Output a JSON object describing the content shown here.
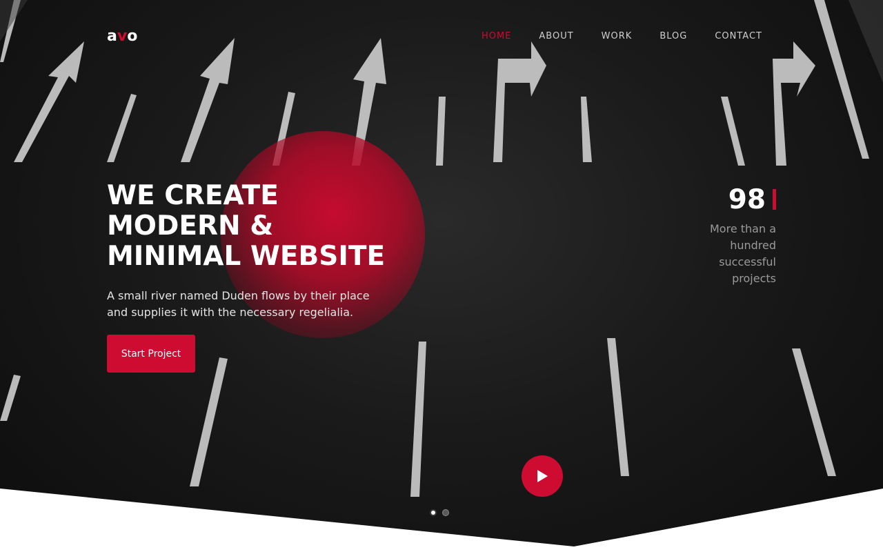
{
  "brand": {
    "logo_prefix": "a",
    "logo_accent": "v",
    "logo_suffix": "o"
  },
  "nav": {
    "items": [
      {
        "label": "HOME",
        "active": true
      },
      {
        "label": "ABOUT",
        "active": false
      },
      {
        "label": "WORK",
        "active": false
      },
      {
        "label": "BLOG",
        "active": false
      },
      {
        "label": "CONTACT",
        "active": false
      }
    ]
  },
  "hero": {
    "headline_line1": "WE CREATE",
    "headline_line2": "MODERN &",
    "headline_line3": "MINIMAL WEBSITE",
    "subtext": "A small river named Duden flows by their place and supplies it with the necessary regelialia.",
    "cta_label": "Start Project"
  },
  "stat": {
    "number": "98",
    "label": "More than a hundred successful projects"
  },
  "slider": {
    "slides": 2,
    "active_index": 0
  },
  "icons": {
    "play": "play-icon"
  },
  "colors": {
    "accent": "#ce0b30",
    "background": "#111111",
    "text": "#ffffff",
    "muted": "#9a9a9a"
  }
}
